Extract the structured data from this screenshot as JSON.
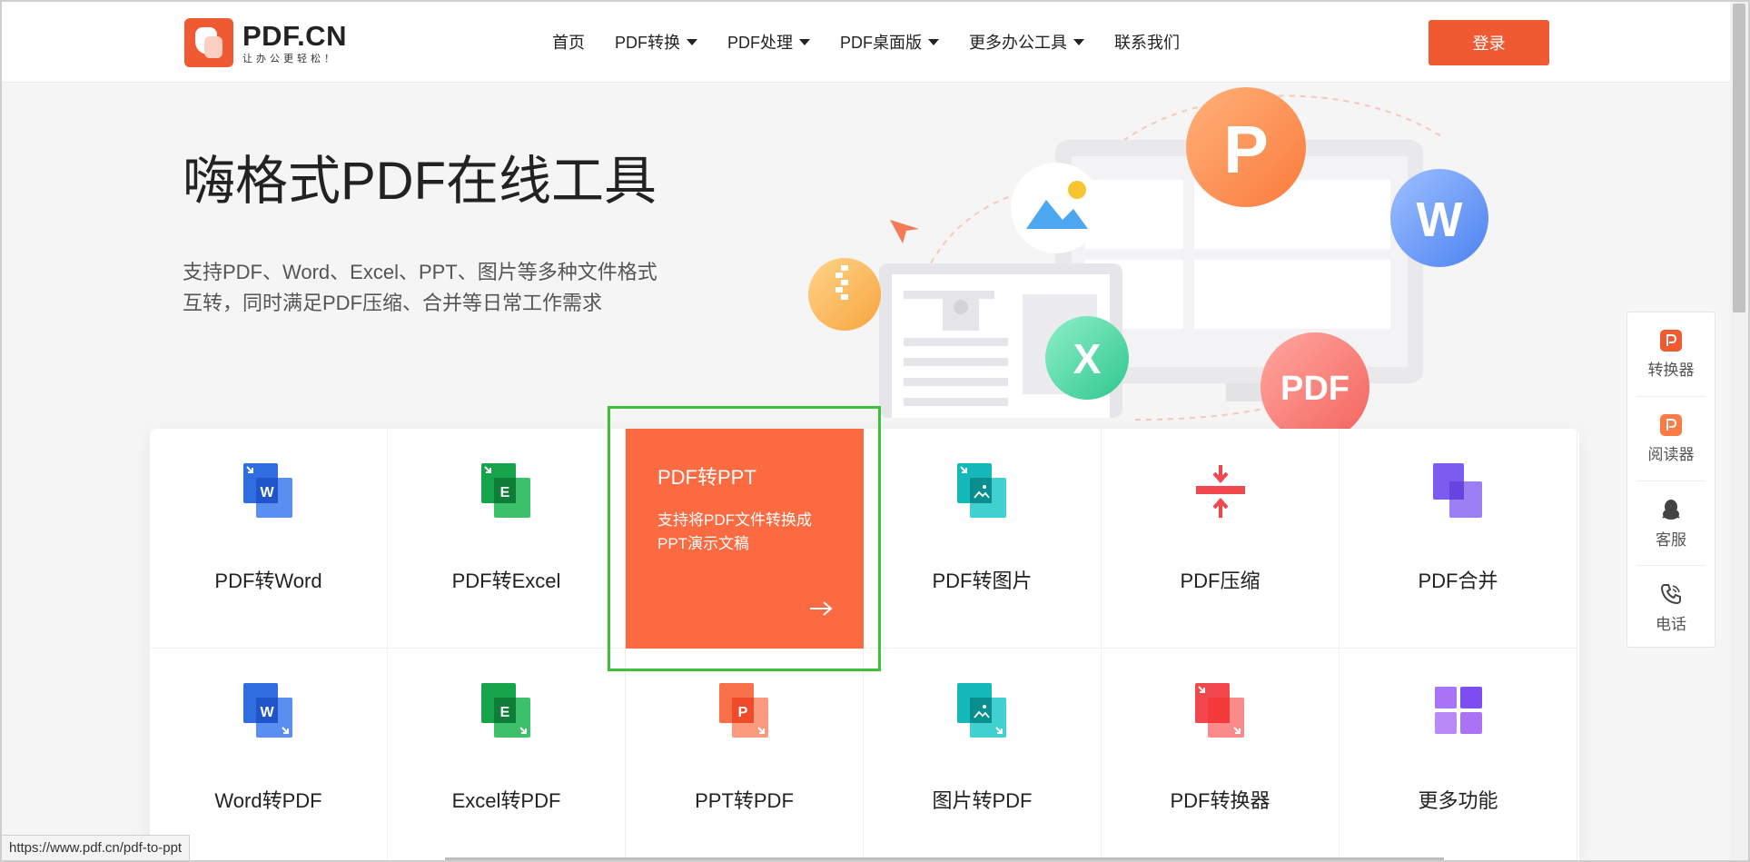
{
  "logo": {
    "title": "PDF.CN",
    "subtitle": "让办公更轻松！"
  },
  "nav": [
    {
      "label": "首页",
      "dropdown": false
    },
    {
      "label": "PDF转换",
      "dropdown": true
    },
    {
      "label": "PDF处理",
      "dropdown": true
    },
    {
      "label": "PDF桌面版",
      "dropdown": true
    },
    {
      "label": "更多办公工具",
      "dropdown": true
    },
    {
      "label": "联系我们",
      "dropdown": false
    }
  ],
  "login_label": "登录",
  "hero": {
    "title": "嗨格式PDF在线工具",
    "desc_line1": "支持PDF、Word、Excel、PPT、图片等多种文件格式",
    "desc_line2": "互转，同时满足PDF压缩、合并等日常工作需求"
  },
  "illustration": {
    "badge_p": "P",
    "badge_w": "W",
    "badge_x": "X",
    "badge_pdf": "PDF"
  },
  "tools_row1": [
    {
      "label": "PDF转Word",
      "icon": "word-doc-icon"
    },
    {
      "label": "PDF转Excel",
      "icon": "excel-doc-icon"
    },
    {
      "label": "PDF转PPT",
      "icon": "ppt-doc-icon",
      "desc": "支持将PDF文件转换成PPT演示文稿"
    },
    {
      "label": "PDF转图片",
      "icon": "image-doc-icon"
    },
    {
      "label": "PDF压缩",
      "icon": "compress-icon"
    },
    {
      "label": "PDF合并",
      "icon": "merge-icon"
    }
  ],
  "tools_row2": [
    {
      "label": "Word转PDF",
      "icon": "word-doc-icon"
    },
    {
      "label": "Excel转PDF",
      "icon": "excel-doc-icon"
    },
    {
      "label": "PPT转PDF",
      "icon": "ppt-doc-icon"
    },
    {
      "label": "图片转PDF",
      "icon": "image-doc-icon"
    },
    {
      "label": "PDF转换器",
      "icon": "converter-icon"
    },
    {
      "label": "更多功能",
      "icon": "grid-icon"
    }
  ],
  "featured": {
    "title": "PDF转PPT",
    "desc_line1": "支持将PDF文件转换成",
    "desc_line2": "PPT演示文稿"
  },
  "side": [
    {
      "label": "转换器",
      "icon": "converter-app-icon"
    },
    {
      "label": "阅读器",
      "icon": "reader-app-icon"
    },
    {
      "label": "客服",
      "icon": "qq-icon"
    },
    {
      "label": "电话",
      "icon": "phone-icon"
    }
  ],
  "status_url": "https://www.pdf.cn/pdf-to-ppt",
  "colors": {
    "brand": "#f05a33",
    "featured": "#fb6a40",
    "highlight": "#3fc03a",
    "word": "#2f6de0",
    "excel": "#16a34a",
    "teal": "#14b8b8",
    "purple": "#7c5cf0"
  },
  "icon_letters": {
    "word": "W",
    "excel": "E",
    "ppt": "P"
  }
}
